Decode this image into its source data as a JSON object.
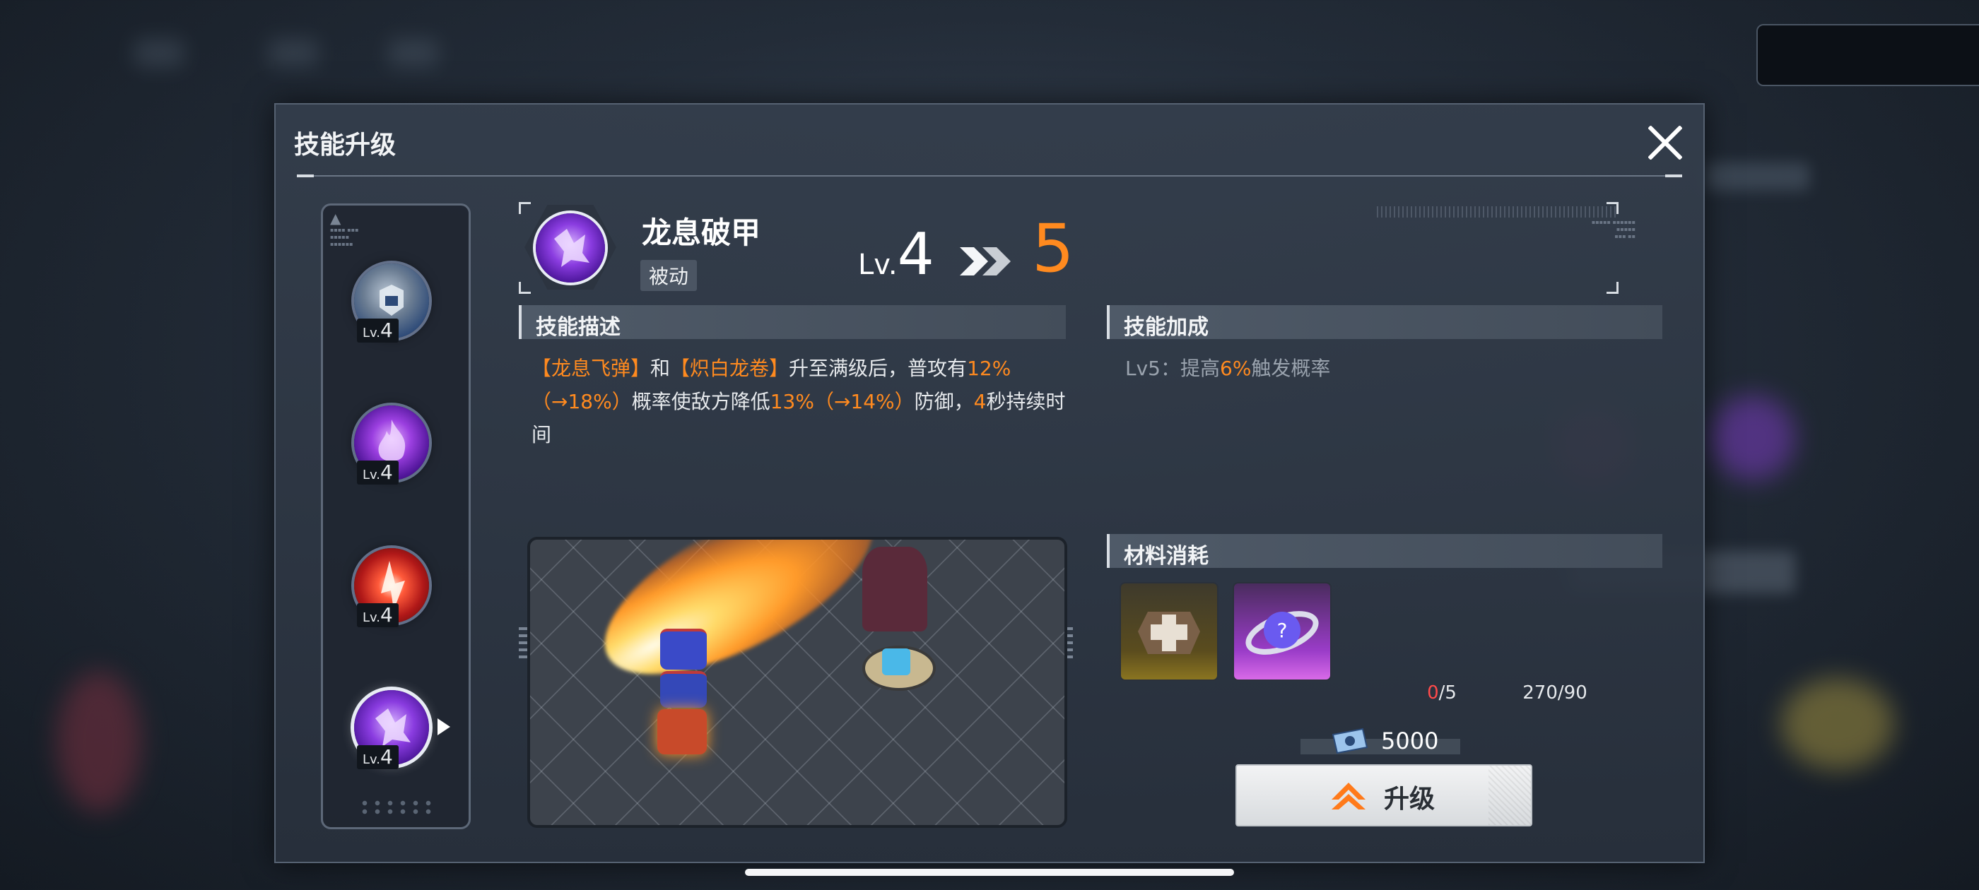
{
  "dialog": {
    "title": "技能升级"
  },
  "skill_list": {
    "items": [
      {
        "icon": "shield-skill-icon",
        "level_prefix": "Lv.",
        "level": "4"
      },
      {
        "icon": "purple-flame-skill-icon",
        "level_prefix": "Lv.",
        "level": "4"
      },
      {
        "icon": "red-flame-skill-icon",
        "level_prefix": "Lv.",
        "level": "4"
      },
      {
        "icon": "dragon-claw-skill-icon",
        "level_prefix": "Lv.",
        "level": "4",
        "selected": true
      }
    ]
  },
  "skill": {
    "name": "龙息破甲",
    "type": "被动",
    "level_prefix": "Lv.",
    "level_from": "4",
    "level_to": "5"
  },
  "description": {
    "header": "技能描述",
    "segments": [
      {
        "text": "【龙息飞弹】",
        "highlight": true
      },
      {
        "text": "和",
        "highlight": false
      },
      {
        "text": "【炽白龙卷】",
        "highlight": true
      },
      {
        "text": "升至满级后，普攻有",
        "highlight": false
      },
      {
        "text": "12%（→18%）",
        "highlight": true
      },
      {
        "text": "概率使敌方降低",
        "highlight": false
      },
      {
        "text": "13%（→14%）",
        "highlight": true
      },
      {
        "text": "防御，",
        "highlight": false
      },
      {
        "text": "4",
        "highlight": true
      },
      {
        "text": "秒持续时间",
        "highlight": false
      }
    ]
  },
  "bonus": {
    "header": "技能加成",
    "prefix": "Lv5：提高",
    "value": "6%",
    "suffix": "触发概率"
  },
  "materials": {
    "header": "材料消耗",
    "items": [
      {
        "icon": "armor-crate-icon",
        "owned": "0",
        "sep_required": "/5",
        "insufficient": true
      },
      {
        "icon": "skill-orb-icon",
        "owned": "270",
        "sep_required": "/90",
        "insufficient": false
      }
    ]
  },
  "cost": {
    "icon": "credit-ticket-icon",
    "value": "5000"
  },
  "upgrade_button": {
    "label": "升级"
  },
  "colors": {
    "accent": "#ff8a1f",
    "insufficient": "#ff4a4a",
    "panel": "#343e4c"
  }
}
